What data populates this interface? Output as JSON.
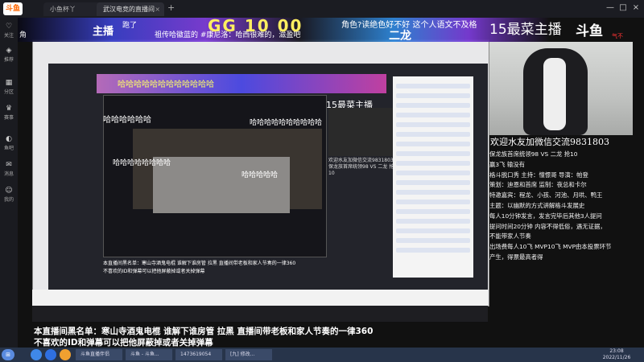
{
  "browser": {
    "logo": "斗鱼",
    "tabs": [
      {
        "label": "小鱼杯丫",
        "close": "×"
      },
      {
        "label": "武汉电竞的直播间",
        "close": "×"
      }
    ],
    "new_tab": "+",
    "window_buttons": [
      "—",
      "□",
      "×"
    ]
  },
  "sidebar": {
    "items": [
      {
        "label": "关注",
        "icon": "heart-icon"
      },
      {
        "label": "推荐",
        "icon": "thumb-icon"
      },
      {
        "label": "分区",
        "icon": "grid-icon"
      },
      {
        "label": "赛事",
        "icon": "trophy-icon"
      },
      {
        "label": "鱼吧",
        "icon": "fish-icon"
      },
      {
        "label": "消息",
        "icon": "message-icon"
      },
      {
        "label": "我的",
        "icon": "user-icon"
      }
    ]
  },
  "overlay": {
    "left_label": "角",
    "anchor_label": "主播",
    "anchor_sub": "跑了",
    "ticker": "祖传哈徽蓝的 #康尼洛：哈西很难的，滋盈吧",
    "big_number": "GG 10  00",
    "question": "角色?读绝色好不好  这个人语文不及格",
    "dragon": "二龙",
    "worst": "15最菜主播",
    "brand": "斗鱼",
    "brand_red": "气不"
  },
  "inner": {
    "banner_text": "哈哈哈哈哈哈哈哈哈哈哈哈",
    "danmu": [
      "哈哈哈哈哈哈",
      "哈哈哈哈哈哈哈哈",
      "哈哈哈哈哈",
      "哈哈哈哈哈哈哈哈哈哈"
    ],
    "title": "15最菜主播",
    "cam_text": "欢迎水友加微信交流9831803 保龙族首席统领98 VS 二龙 抢10",
    "bottom1": "本直播间黑名单：寒山寺酒鬼电棍 谁解下谁房管 拉黑  直播间带老板和家人节奏的一律360",
    "bottom2": "不喜欢的ID和弹幕可以把他屏蔽掉或者关掉弹幕"
  },
  "right_panel": {
    "wechat": "欢迎水友加微信交流9831803",
    "lines": [
      "保龙族首席统领98 VS 二龙 抢10",
      "赢3飞  输没有",
      "格斗脱口秀 主持：憧憬哥 导演：帕登",
      "策划：迪恩和首席 监制：夜总和卡尔",
      "特邀嘉宾：程龙、小孩、河池、月哄、鸭王",
      "主题：以幽默的方式讲解格斗发展史",
      "每人10分钟发言，发言完毕后其他3人提问",
      "提问时间20分钟 内容不得低俗，遇无证据，",
      "不能带家人节奏",
      "出场费每人10飞 MVP10飞 MVP由本投票环节",
      "产生，得票最高者得"
    ]
  },
  "subtitles": {
    "line1": "本直播间黑名单：寒山寺酒鬼电棍 谁解下谁房管 拉黑  直播间带老板和家人节奏的一律360",
    "line2": "不喜欢的ID和弹幕可以把他屏蔽掉或者关掉弹幕"
  },
  "taskbar": {
    "apps": [
      "斗鱼直播伴侣",
      "斗鱼 - 斗鱼...",
      "1473619054",
      "[九]  修改..."
    ],
    "time": "23:08",
    "date": "2022/11/26"
  }
}
